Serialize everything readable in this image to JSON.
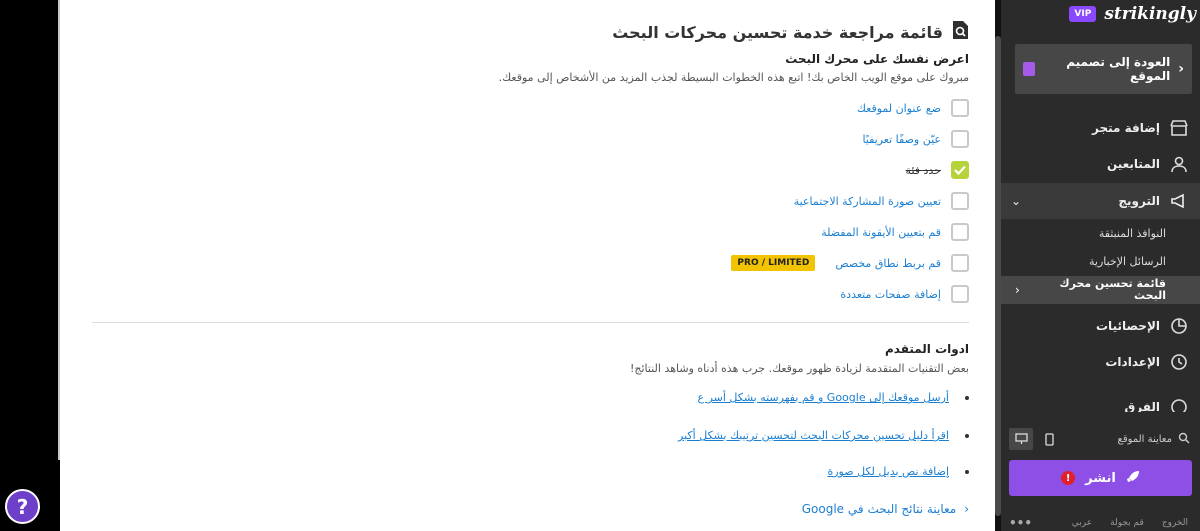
{
  "main": {
    "title": "قائمة مراجعة خدمة تحسين محركات البحث",
    "section1": {
      "heading": "اعرض نفسك على محرك البحث",
      "description": "مبروك على موقع الويب الخاص بك! اتبع هذه الخطوات البسيطة لجذب المزيد من الأشخاص إلى موقعك."
    },
    "checklist": [
      {
        "label": "ضع عنوان لموقعك",
        "checked": false
      },
      {
        "label": "عيّن وصفًا تعريفيًا",
        "checked": false
      },
      {
        "label": "حدد فئة",
        "checked": true
      },
      {
        "label": "تعيين صورة المشاركة الاجتماعية",
        "checked": false
      },
      {
        "label": "قم بتعيين الأيقونة المفضلة",
        "checked": false
      },
      {
        "label": "قم بربط نطاق مخصص",
        "checked": false,
        "badge": "PRO / LIMITED"
      },
      {
        "label": "إضافة صفحات متعددة",
        "checked": false
      }
    ],
    "section2": {
      "heading": "ادوات المتقدم",
      "description": "بعض التقنيات المتقدمة لزيادة ظهور موقعك. جرب هذه أدناه وشاهد النتائج!"
    },
    "links": [
      "أرسل موقعك إلى Google و قم بفهرسته بشكل أسر ع",
      "اقرأ دليل تحسين محركات البحث لتحسين ترتيبك بشكل أكبر",
      "إضافة نص بديل لكل صورة"
    ],
    "preview_label": "معاينة نتائج البحث في Google"
  },
  "help_label": "?",
  "sidebar": {
    "logo": "strikingly",
    "vip": "VIP",
    "back_label": "العودة إلى تصميم الموقع",
    "items": [
      {
        "label": "إضافة متجر",
        "icon": "store-icon"
      },
      {
        "label": "المتابعين",
        "icon": "followers-icon"
      },
      {
        "label": "الترويج",
        "icon": "megaphone-icon"
      }
    ],
    "sub_items": [
      "النوافذ المنبثقة",
      "الرسائل الإخبارية",
      "قائمة تحسين محرك البحث"
    ],
    "items2": [
      {
        "label": "الإحصائيات",
        "icon": "stats-icon"
      },
      {
        "label": "الإعدادات",
        "icon": "settings-icon"
      },
      {
        "label": "الفرق",
        "icon": "team-icon"
      }
    ],
    "view_label": "معاينة الموقع",
    "publish_label": "انشر",
    "footer": [
      "الخروج",
      "قم بجولة",
      "عربي"
    ]
  },
  "colors": {
    "accent": "#8d4fe6",
    "link": "#1b7fd1",
    "check": "#b6d33c",
    "badge": "#f2c300"
  }
}
